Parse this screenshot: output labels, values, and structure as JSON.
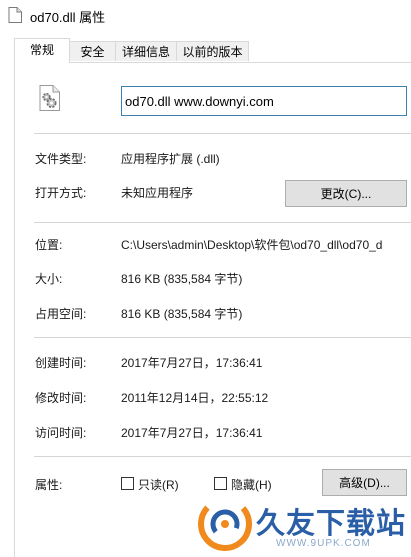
{
  "window": {
    "title": "od70.dll 属性"
  },
  "tabs": [
    {
      "label": "常规",
      "active": true
    },
    {
      "label": "安全",
      "active": false
    },
    {
      "label": "详细信息",
      "active": false
    },
    {
      "label": "以前的版本",
      "active": false
    }
  ],
  "file": {
    "icon": "dll-gear-file-icon",
    "name_value": "od70.dll www.downyi.com"
  },
  "rows": {
    "type": {
      "label": "文件类型:",
      "value": "应用程序扩展 (.dll)"
    },
    "open_with": {
      "label": "打开方式:",
      "value": "未知应用程序",
      "button": "更改(C)..."
    },
    "location": {
      "label": "位置:",
      "value": "C:\\Users\\admin\\Desktop\\软件包\\od70_dll\\od70_d"
    },
    "size": {
      "label": "大小:",
      "value": "816 KB (835,584 字节)"
    },
    "disk_size": {
      "label": "占用空间:",
      "value": "816 KB (835,584 字节)"
    },
    "created": {
      "label": "创建时间:",
      "value": "2017年7月27日，17:36:41"
    },
    "modified": {
      "label": "修改时间:",
      "value": "2011年12月14日，22:55:12"
    },
    "accessed": {
      "label": "访问时间:",
      "value": "2017年7月27日，17:36:41"
    }
  },
  "attributes": {
    "label": "属性:",
    "readonly": {
      "label": "只读(R)",
      "checked": false
    },
    "hidden": {
      "label": "隐藏(H)",
      "checked": false
    },
    "advanced_button": "高级(D)..."
  },
  "watermark": {
    "text": "久友下载站",
    "url": "WWW.9UPK.COM"
  },
  "colors": {
    "input_border": "#3c7fb1",
    "button_bg": "#e1e1e1",
    "watermark_blue": "#2a5fa8",
    "watermark_orange": "#f08a1c"
  }
}
